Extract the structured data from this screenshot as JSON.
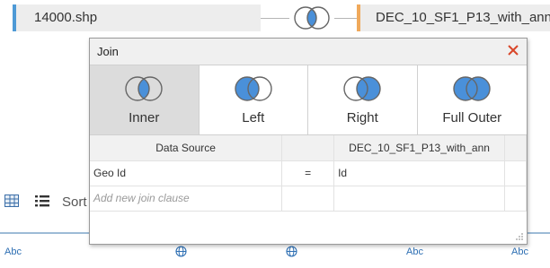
{
  "top_bar": {
    "left_source": "14000.shp",
    "right_source": "DEC_10_SF1_P13_with_ann",
    "left_color": "#4e9ad6",
    "right_color": "#f0a95b",
    "join_icon": "inner-join-venn-icon"
  },
  "join_dialog": {
    "title": "Join",
    "close_icon": "close-icon",
    "join_types": [
      {
        "label": "Inner",
        "icon": "inner-join-icon",
        "selected": true
      },
      {
        "label": "Left",
        "icon": "left-join-icon",
        "selected": false
      },
      {
        "label": "Right",
        "icon": "right-join-icon",
        "selected": false
      },
      {
        "label": "Full Outer",
        "icon": "full-outer-join-icon",
        "selected": false
      }
    ],
    "grid": {
      "headers": {
        "left": "Data Source",
        "op": "",
        "right": "DEC_10_SF1_P13_with_ann"
      },
      "rows": [
        {
          "left": "Geo Id",
          "op": "=",
          "right": "Id"
        }
      ],
      "add_clause_placeholder": "Add new join clause"
    },
    "accent": "#4a90d9",
    "close_color": "#d9472b"
  },
  "worksheet": {
    "sort_label": "Sort",
    "grid_view_icon": "grid-view-icon",
    "list_view_icon": "list-view-icon",
    "column_types": [
      "Abc",
      "globe-icon",
      "globe-icon",
      "Abc",
      "Abc"
    ]
  }
}
